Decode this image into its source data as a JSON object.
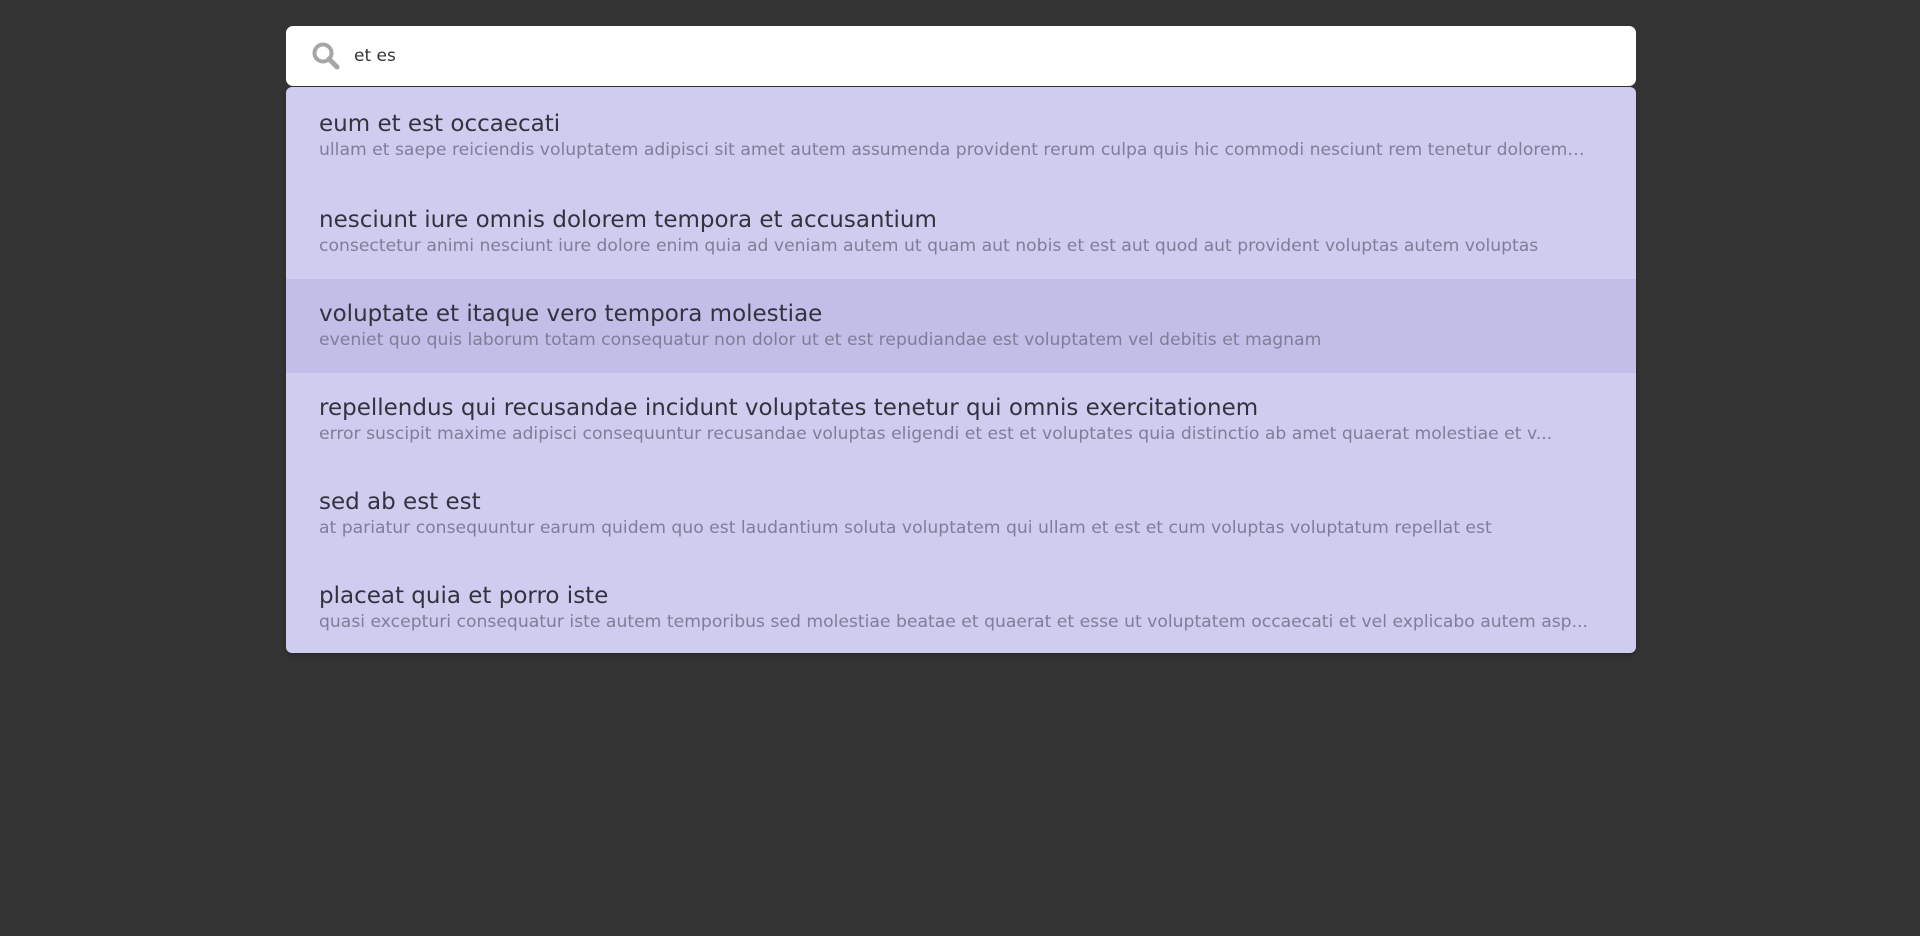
{
  "search": {
    "value": "et es",
    "icon": "search-icon"
  },
  "colors": {
    "background": "#333333",
    "dropdown": "#cfcdef",
    "highlight": "#c1bee7",
    "title_text": "#333340",
    "desc_text": "#7f7e98"
  },
  "results": [
    {
      "title": "eum et est occaecati",
      "description": "ullam et saepe reiciendis voluptatem adipisci sit amet autem assumenda provident rerum culpa quis hic commodi nesciunt rem tenetur doloremqu..."
    },
    {
      "title": "nesciunt iure omnis dolorem tempora et accusantium",
      "description": "consectetur animi nesciunt iure dolore enim quia ad veniam autem ut quam aut nobis et est aut quod aut provident voluptas autem voluptas"
    },
    {
      "title": "voluptate et itaque vero tempora molestiae",
      "description": "eveniet quo quis laborum totam consequatur non dolor ut et est repudiandae est voluptatem vel debitis et magnam",
      "active": true
    },
    {
      "title": "repellendus qui recusandae incidunt voluptates tenetur qui omnis exercitationem",
      "description": "error suscipit maxime adipisci consequuntur recusandae voluptas eligendi et est et voluptates quia distinctio ab amet quaerat molestiae et v..."
    },
    {
      "title": "sed ab est est",
      "description": "at pariatur consequuntur earum quidem quo est laudantium soluta voluptatem qui ullam et est et cum voluptas voluptatum repellat est"
    },
    {
      "title": "placeat quia et porro iste",
      "description": "quasi excepturi consequatur iste autem temporibus sed molestiae beatae et quaerat et esse ut voluptatem occaecati et vel explicabo autem asp..."
    }
  ]
}
